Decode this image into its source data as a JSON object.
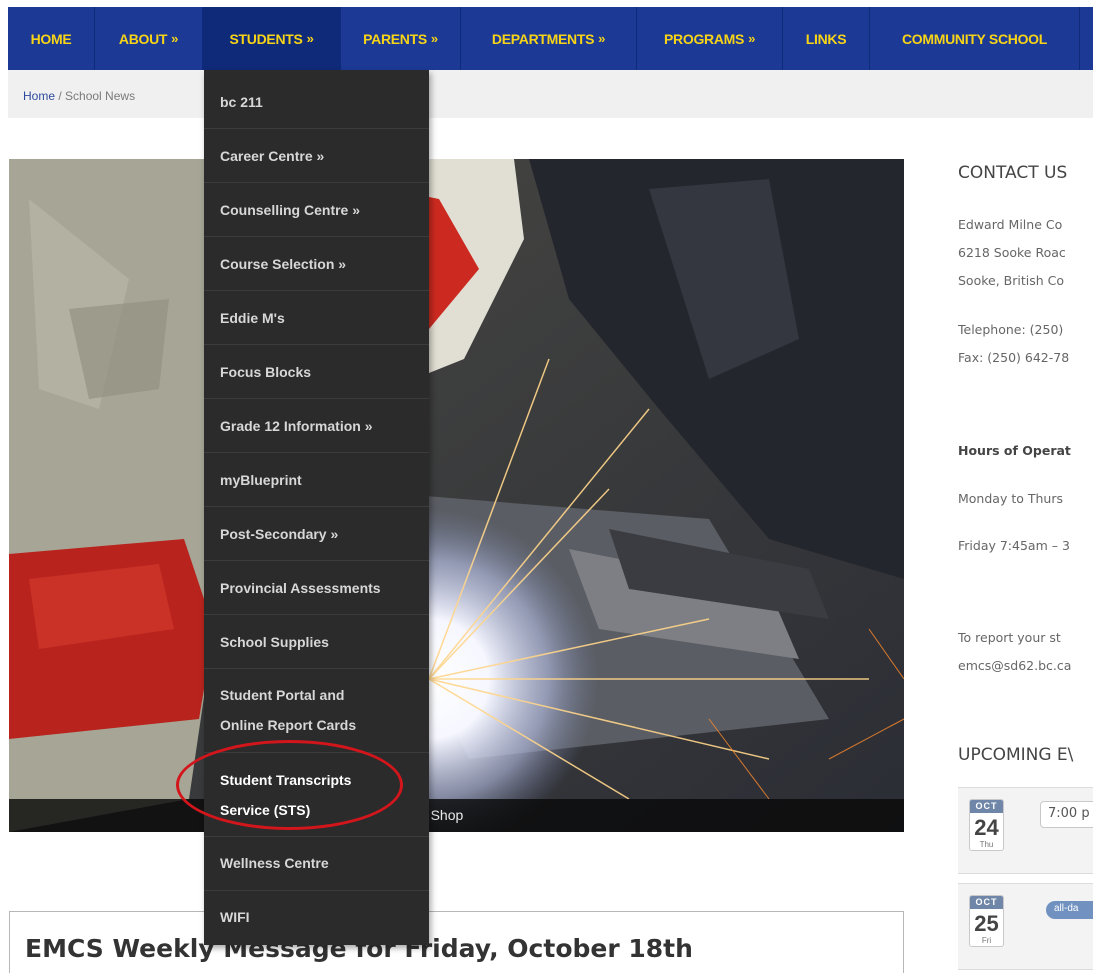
{
  "nav": {
    "items": [
      {
        "label": "HOME",
        "arrow": ""
      },
      {
        "label": "ABOUT",
        "arrow": "»"
      },
      {
        "label": "STUDENTS",
        "arrow": "»"
      },
      {
        "label": "PARENTS",
        "arrow": "»"
      },
      {
        "label": "DEPARTMENTS",
        "arrow": "»"
      },
      {
        "label": "PROGRAMS",
        "arrow": "»"
      },
      {
        "label": "LINKS",
        "arrow": ""
      },
      {
        "label": "COMMUNITY SCHOOL",
        "arrow": ""
      }
    ],
    "active_item": "STUDENTS"
  },
  "breadcrumb": {
    "home": "Home",
    "separator": " / ",
    "current": "School News"
  },
  "dropdown": {
    "items": [
      {
        "line1": "bc 211",
        "line2": ""
      },
      {
        "line1": "Career Centre »",
        "line2": ""
      },
      {
        "line1": "Counselling Centre »",
        "line2": ""
      },
      {
        "line1": "Course Selection »",
        "line2": ""
      },
      {
        "line1": "Eddie M's",
        "line2": ""
      },
      {
        "line1": "Focus Blocks",
        "line2": ""
      },
      {
        "line1": "Grade 12 Information »",
        "line2": ""
      },
      {
        "line1": "myBlueprint",
        "line2": ""
      },
      {
        "line1": "Post-Secondary »",
        "line2": ""
      },
      {
        "line1": "Provincial Assessments",
        "line2": ""
      },
      {
        "line1": "School Supplies",
        "line2": ""
      },
      {
        "line1": "Student Portal and",
        "line2": "Online Report Cards"
      },
      {
        "line1": "Student Transcripts",
        "line2": "Service (STS)"
      },
      {
        "line1": "Wellness Centre",
        "line2": ""
      },
      {
        "line1": "WIFI",
        "line2": ""
      }
    ],
    "highlighted_item": "Student Transcripts Service (STS)",
    "highlight_color": "#d3151c"
  },
  "hero": {
    "caption": "letal Shop"
  },
  "article": {
    "title": "EMCS Weekly Message for Friday, October 18th"
  },
  "sidebar": {
    "contact_heading": "CONTACT US",
    "address": [
      "Edward Milne Co",
      "6218 Sooke Roac",
      "Sooke, British Co"
    ],
    "phone": "Telephone: (250)",
    "fax": "Fax: (250) 642-78",
    "hours_heading": "Hours of Operat",
    "hours_weekday": "Monday to Thurs",
    "hours_friday": "Friday 7:45am – 3",
    "report_line1": "To report your st",
    "report_line2": "emcs@sd62.bc.ca",
    "events_heading": "UPCOMING E\\",
    "events": [
      {
        "month": "OCT",
        "day": "24",
        "dow": "Thu",
        "time": "7:00 p",
        "badge": ""
      },
      {
        "month": "OCT",
        "day": "25",
        "dow": "Fri",
        "time": "",
        "badge": "all-da"
      }
    ]
  },
  "colors": {
    "nav_bg": "#1c3a95",
    "nav_text": "#f7d417",
    "dropdown_bg": "#2b2b2b",
    "event_month_bg": "#6f86a8",
    "event_badge_bg": "#7192c0"
  }
}
